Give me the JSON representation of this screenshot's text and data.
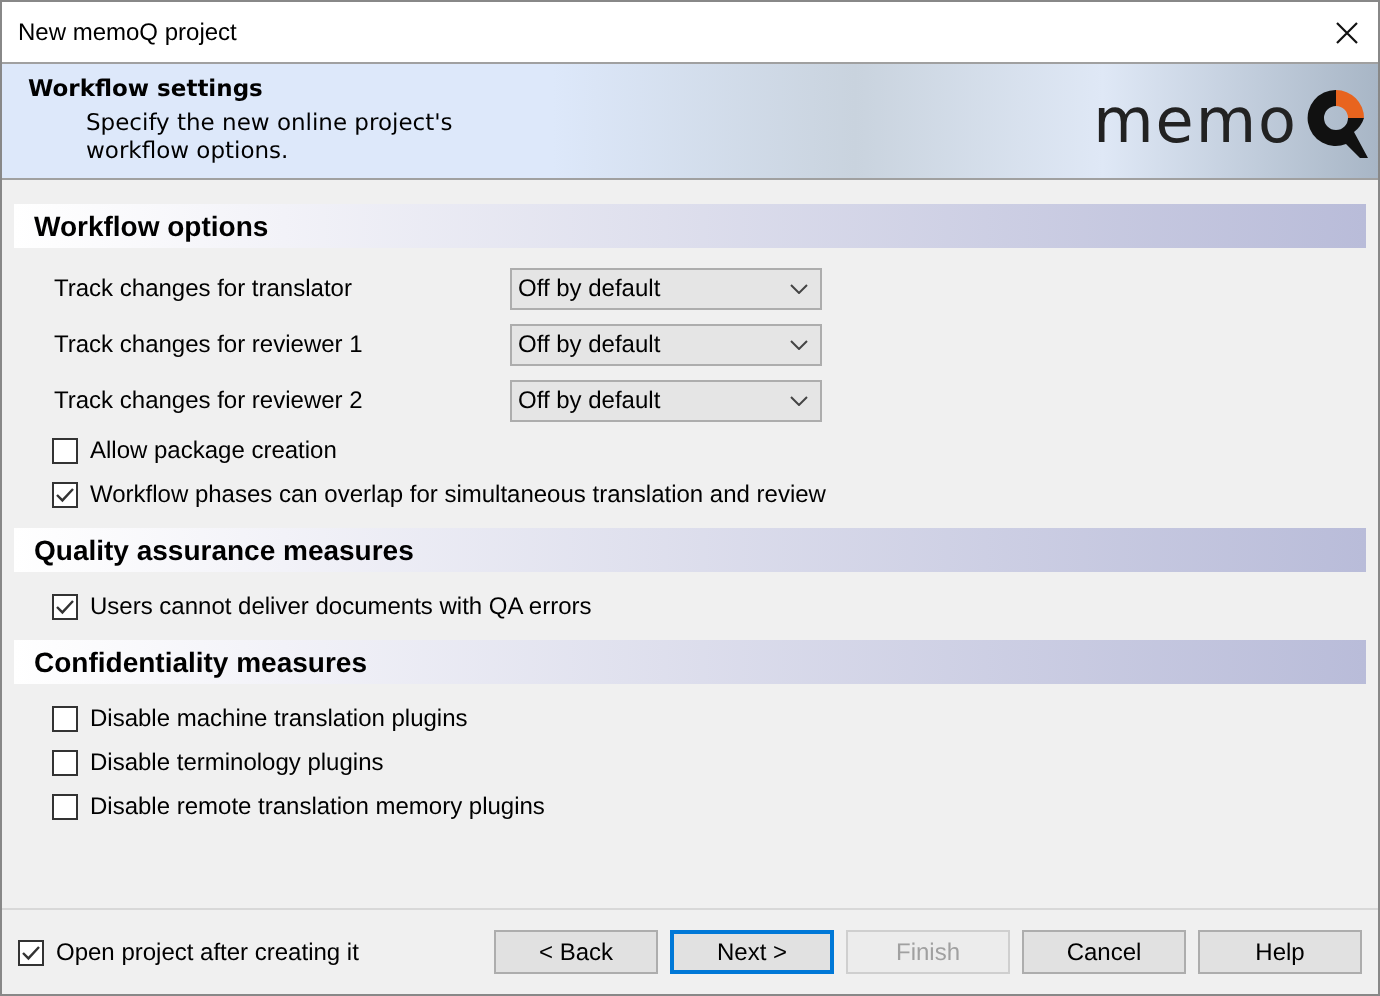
{
  "window": {
    "title": "New memoQ project"
  },
  "header": {
    "title": "Workflow settings",
    "description": "Specify the new online project's workflow options.",
    "logo_text": "memo"
  },
  "sections": [
    {
      "title": "Workflow options",
      "items": [
        {
          "kind": "dropdown",
          "label": "Track changes for translator",
          "value": "Off by default"
        },
        {
          "kind": "dropdown",
          "label": "Track changes for reviewer 1",
          "value": "Off by default"
        },
        {
          "kind": "dropdown",
          "label": "Track changes for reviewer 2",
          "value": "Off by default"
        },
        {
          "kind": "checkbox",
          "label": "Allow package creation",
          "checked": false
        },
        {
          "kind": "checkbox",
          "label": "Workflow phases can overlap for simultaneous translation and review",
          "checked": true
        }
      ]
    },
    {
      "title": "Quality assurance measures",
      "items": [
        {
          "kind": "checkbox",
          "label": "Users cannot deliver documents with QA errors",
          "checked": true
        }
      ]
    },
    {
      "title": "Confidentiality measures",
      "items": [
        {
          "kind": "checkbox",
          "label": "Disable machine translation plugins",
          "checked": false
        },
        {
          "kind": "checkbox",
          "label": "Disable terminology plugins",
          "checked": false
        },
        {
          "kind": "checkbox",
          "label": "Disable remote translation memory plugins",
          "checked": false
        }
      ]
    }
  ],
  "footer": {
    "open_after": {
      "label": "Open project after creating it",
      "checked": true
    },
    "buttons": [
      {
        "label": "< Back",
        "disabled": false,
        "default": false
      },
      {
        "label": "Next >",
        "disabled": false,
        "default": true
      },
      {
        "label": "Finish",
        "disabled": true,
        "default": false
      },
      {
        "label": "Cancel",
        "disabled": false,
        "default": false
      },
      {
        "label": "Help",
        "disabled": false,
        "default": false
      }
    ]
  }
}
